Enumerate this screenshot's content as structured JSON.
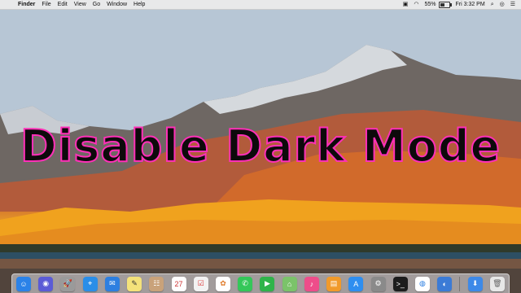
{
  "menubar": {
    "apple": "",
    "menus": [
      "Finder",
      "File",
      "Edit",
      "View",
      "Go",
      "Window",
      "Help"
    ],
    "status": {
      "battery_text": "55%",
      "battery_level": 0.55,
      "day_time": "Fri 3:32 PM",
      "icons": [
        "display-icon",
        "wifi-icon",
        "battery-icon",
        "clock-text",
        "search-icon",
        "siri-icon",
        "list-icon"
      ]
    }
  },
  "overlay": {
    "title": "Disable Dark Mode",
    "text_color": "#0d0a0b",
    "stroke_color": "#ff2fb8"
  },
  "dock": {
    "calendar_day": "27",
    "items": [
      {
        "name": "finder-icon",
        "color": "#2b82e8"
      },
      {
        "name": "siri-icon",
        "color": "#5b5bd6"
      },
      {
        "name": "launchpad-icon",
        "color": "#9a9a9a"
      },
      {
        "name": "safari-icon",
        "color": "#2a8ee8"
      },
      {
        "name": "mail-icon",
        "color": "#2d7fe0"
      },
      {
        "name": "notes-icon",
        "color": "#f4e27a"
      },
      {
        "name": "contacts-icon",
        "color": "#c9a27a"
      },
      {
        "name": "calendar-icon",
        "color": "#ffffff"
      },
      {
        "name": "reminders-icon",
        "color": "#f2f2f2"
      },
      {
        "name": "photos-icon",
        "color": "#ffffff"
      },
      {
        "name": "messages-icon",
        "color": "#34c759"
      },
      {
        "name": "facetime-icon",
        "color": "#2fb44a"
      },
      {
        "name": "maps-icon",
        "color": "#7bc36a"
      },
      {
        "name": "itunes-icon",
        "color": "#ee4d8a"
      },
      {
        "name": "ibooks-icon",
        "color": "#f19a2a"
      },
      {
        "name": "appstore-icon",
        "color": "#2e8ef0"
      },
      {
        "name": "system-preferences-icon",
        "color": "#8a8a8a"
      },
      {
        "name": "terminal-icon",
        "color": "#1c1c1c"
      },
      {
        "name": "chrome-icon",
        "color": "#ffffff"
      },
      {
        "name": "browser-icon",
        "color": "#3b7bd6"
      },
      {
        "name": "downloads-icon",
        "color": "#3d89e8"
      },
      {
        "name": "trash-icon",
        "color": "#e7e7e7"
      }
    ]
  }
}
